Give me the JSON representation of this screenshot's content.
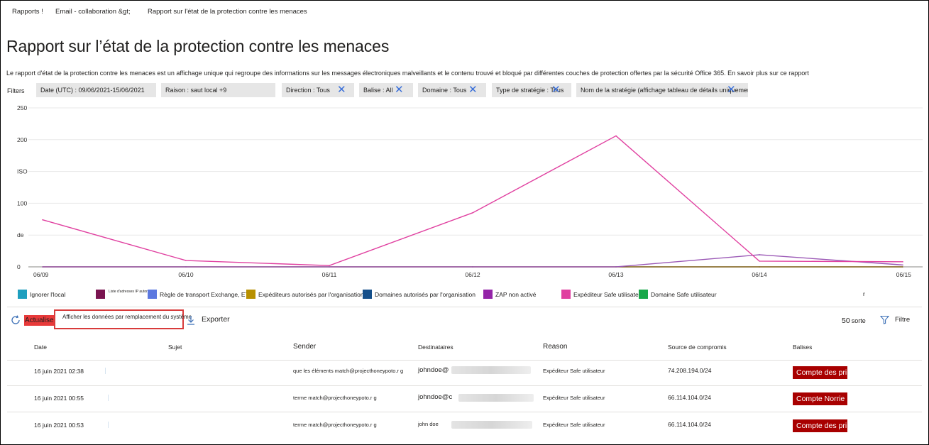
{
  "breadcrumb": {
    "item1": "Rapports !",
    "item2": "Email - collaboration &gt;",
    "item3": "Rapport sur l'état de la protection contre les menaces"
  },
  "page": {
    "title": "Rapport sur l’état de la protection contre les menaces",
    "description": "Le rapport d'état de la protection contre les menaces est un affichage unique qui regroupe des informations sur les messages électroniques malveillants et le contenu trouvé et bloqué par différentes couches de protection offertes par la sécurité Office 365. En savoir plus sur ce rapport"
  },
  "filters": {
    "label": "Filters",
    "date": "Date (UTC) : 09/06/2021-15/06/2021",
    "raison": "Raison : saut local +9",
    "direction": "Direction : Tous",
    "balise": "Balise : All",
    "domaine": "Domaine : Tous",
    "type_strategie": "Type de stratégie : Tous",
    "nom_strategie": "Nom de la stratégie (affichage tableau de détails uniquement) : Tous"
  },
  "chart_data": {
    "type": "line",
    "x": [
      "06/09",
      "06/10",
      "06/11",
      "06/12",
      "06/13",
      "06/14",
      "06/15"
    ],
    "y_tick_labels": [
      "250",
      "200",
      "ISO",
      "100",
      "de",
      "0"
    ],
    "ylim": [
      0,
      250
    ],
    "grid": true,
    "series": [
      {
        "name": "Expéditeur Safe utilisateur",
        "color": "#e040a0",
        "values": [
          74,
          10,
          2,
          85,
          206,
          9,
          8
        ]
      },
      {
        "name": "ZAP non activé",
        "color": "#9b59b6",
        "values": [
          0,
          0,
          0,
          0,
          0,
          19,
          3
        ]
      },
      {
        "name": "Domaine Safe utilisateur",
        "color": "#7a5a10",
        "values": [
          0,
          0,
          0,
          0,
          0,
          0,
          0
        ]
      }
    ]
  },
  "legend": {
    "items": [
      {
        "label": "Ignorer l'local",
        "color": "#1e9fbf"
      },
      {
        "label": "Liste d'adresses IP autorisées",
        "color": "#7a1450"
      },
      {
        "label": "Règle de transport Exchange, ETR",
        "color": "#5c78e0"
      },
      {
        "label": "Expéditeurs autorisés  par  l'organisation",
        "color": "#b89000"
      },
      {
        "label": "Domaines autorisés  par  l'organisation",
        "color": "#154f8a"
      },
      {
        "label": "ZAP non activé",
        "color": "#9424a8"
      },
      {
        "label": "Expéditeur Safe utilisateur",
        "color": "#e040a0"
      },
      {
        "label": "Domaine Safe utilisateur",
        "color": "#19a84a"
      }
    ],
    "extra": "r"
  },
  "toolbar": {
    "refresh": "Actualiser",
    "override": "Afficher les données par remplacement du système",
    "export": "Exporter",
    "count": "50",
    "count_label": "sorte",
    "filter": "Filtre"
  },
  "table": {
    "headers": {
      "date": "Date",
      "subject": "Sujet",
      "sender": "Sender",
      "recipients": "Destinataires",
      "reason": "Reason",
      "source": "Source de compromis",
      "tags": "Balises"
    },
    "rows": [
      {
        "date": "16 juin 2021 02:38",
        "sender": "que  les  éléments  match@projecthoneypoto.r g",
        "recipient": "johndoe@",
        "reason": "Expéditeur  Safe utilisateur",
        "source": "74.208.194.0/24",
        "tag": "Compte des pri"
      },
      {
        "date": "16 juin 2021 00:55",
        "sender": "terme  match@projecthoneypoto.r g",
        "recipient": "johndoe@c",
        "reason": "Expéditeur  Safe utilisateur",
        "source": "66.114.104.0/24",
        "tag": "Compte Norrie"
      },
      {
        "date": "16 juin 2021 00:53",
        "sender": "terme match@projecthoneypoto.r g",
        "recipient": "john doe",
        "reason": "Expéditeur  Safe utilisateur",
        "source": "66.114.104.0/24",
        "tag": "Compte des pri"
      }
    ]
  }
}
